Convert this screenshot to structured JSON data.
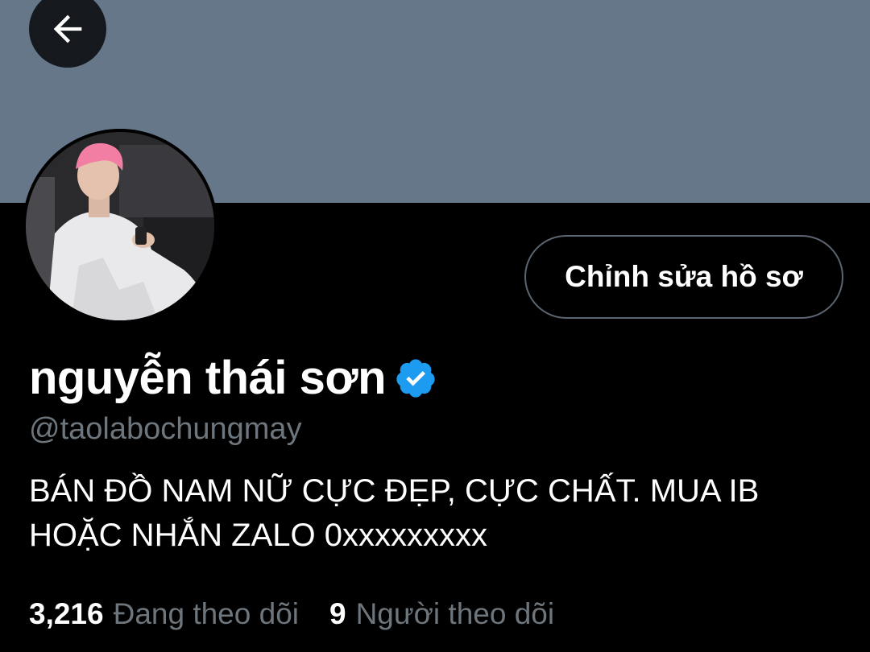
{
  "header": {
    "banner_color": "#66778a",
    "back_icon": "arrow-left-icon"
  },
  "profile": {
    "avatar_icon": "profile-photo",
    "edit_button_label": "Chỉnh sửa hồ sơ",
    "display_name": "nguyễn thái sơn",
    "verified_icon": "verified-badge-icon",
    "verified_color": "#1d9bf0",
    "handle": "@taolabochungmay",
    "bio_line1": "BÁN ĐỒ NAM NỮ CỰC ĐẸP, CỰC CHẤT. MUA IB",
    "bio_line2": "HOẶC NHẮN ZALO 0xxxxxxxxx"
  },
  "stats": {
    "following_count": "3,216",
    "following_label": "Đang theo dõi",
    "followers_count": "9",
    "followers_label": "Người theo dõi"
  }
}
